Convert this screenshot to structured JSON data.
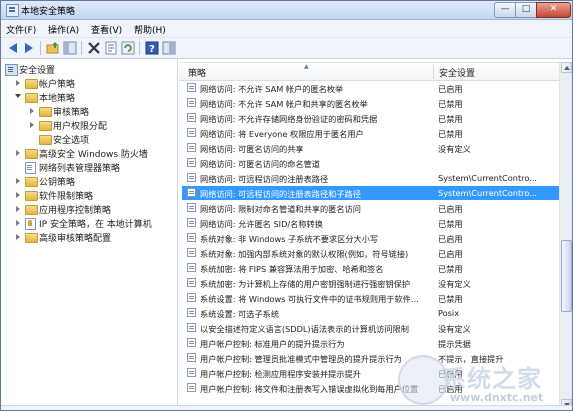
{
  "window": {
    "title": "本地安全策略",
    "controls": {
      "minimize": "—",
      "maximize": "□",
      "close": "✕"
    }
  },
  "menu": [
    "文件(F)",
    "操作(A)",
    "查看(V)",
    "帮助(H)"
  ],
  "toolbar": {
    "icons": [
      "back-icon",
      "forward-icon",
      "up-folder-icon",
      "show-tree-icon",
      "delete-icon",
      "properties-icon",
      "refresh-icon",
      "export-icon",
      "help-icon",
      "panel-icon"
    ]
  },
  "tree": {
    "items": [
      {
        "label": "安全设置",
        "icon": "security-settings-icon",
        "expander": "open"
      },
      {
        "label": "帐户策略",
        "icon": "folder-icon",
        "expander": "closed"
      },
      {
        "label": "本地策略",
        "icon": "folder-icon",
        "expander": "open"
      },
      {
        "label": "审核策略",
        "icon": "folder-icon",
        "expander": "closed"
      },
      {
        "label": "用户权限分配",
        "icon": "folder-icon",
        "expander": "closed"
      },
      {
        "label": "安全选项",
        "icon": "folder-icon",
        "expander": "none"
      },
      {
        "label": "高级安全 Windows 防火墙",
        "icon": "folder-icon",
        "expander": "closed"
      },
      {
        "label": "网络列表管理器策略",
        "icon": "document-icon",
        "expander": "none"
      },
      {
        "label": "公钥策略",
        "icon": "folder-icon",
        "expander": "closed"
      },
      {
        "label": "软件限制策略",
        "icon": "folder-icon",
        "expander": "closed"
      },
      {
        "label": "应用程序控制策略",
        "icon": "folder-icon",
        "expander": "closed"
      },
      {
        "label": "IP 安全策略，在 本地计算机",
        "icon": "ip-security-icon",
        "expander": "closed"
      },
      {
        "label": "高级审核策略配置",
        "icon": "folder-icon",
        "expander": "closed"
      }
    ]
  },
  "grid": {
    "headers": {
      "policy": "策略",
      "setting": "安全设置"
    },
    "rows": [
      {
        "policy": "网络访问: 不允许 SAM 帐户的匿名枚举",
        "setting": "已启用"
      },
      {
        "policy": "网络访问: 不允许 SAM 帐户和共享的匿名枚举",
        "setting": "已禁用"
      },
      {
        "policy": "网络访问: 不允许存储网络身份验证的密码和凭据",
        "setting": "已禁用"
      },
      {
        "policy": "网络访问: 将 Everyone 权限应用于匿名用户",
        "setting": "已禁用"
      },
      {
        "policy": "网络访问: 可匿名访问的共享",
        "setting": "没有定义"
      },
      {
        "policy": "网络访问: 可匿名访问的命名管道",
        "setting": ""
      },
      {
        "policy": "网络访问: 可远程访问的注册表路径",
        "setting": "System\\CurrentContro..."
      },
      {
        "policy": "网络访问: 可远程访问的注册表路径和子路径",
        "setting": "System\\CurrentContro..."
      },
      {
        "policy": "网络访问: 限制对命名管道和共享的匿名访问",
        "setting": "已启用"
      },
      {
        "policy": "网络访问: 允许匿名 SID/名称转换",
        "setting": "已禁用"
      },
      {
        "policy": "系统对象: 非 Windows 子系统不要求区分大小写",
        "setting": "已启用"
      },
      {
        "policy": "系统对象: 加强内部系统对象的默认权限(例如，符号链接)",
        "setting": "已启用"
      },
      {
        "policy": "系统加密: 将 FIPS 兼容算法用于加密、哈希和签名",
        "setting": "已禁用"
      },
      {
        "policy": "系统加密: 为计算机上存储的用户密钥强制进行强密钥保护",
        "setting": "没有定义"
      },
      {
        "policy": "系统设置: 将 Windows 可执行文件中的证书规则用于软件...",
        "setting": "已禁用"
      },
      {
        "policy": "系统设置: 可选子系统",
        "setting": "Posix"
      },
      {
        "policy": "以安全描述符定义语言(SDDL)语法表示的计算机访问限制",
        "setting": "没有定义"
      },
      {
        "policy": "用户帐户控制: 标准用户的提升提示行为",
        "setting": "提示凭据"
      },
      {
        "policy": "用户帐户控制: 管理员批准模式中管理员的提升提示行为",
        "setting": "不提示，直接提升"
      },
      {
        "policy": "用户帐户控制: 检测应用程序安装并提示提升",
        "setting": "已启用"
      },
      {
        "policy": "用户帐户控制: 将文件和注册表写入错误虚拟化到每用户位置",
        "setting": "已启用"
      }
    ],
    "selected_index": 7
  },
  "watermark": {
    "text": "系统之家",
    "url": "www.dnxtc.net"
  }
}
